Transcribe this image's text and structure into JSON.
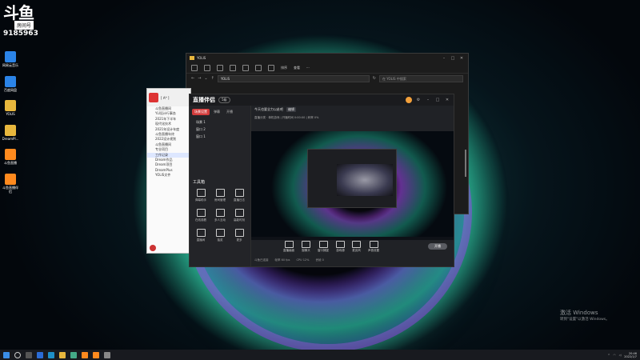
{
  "desktop": {
    "logo": {
      "mark": "斗鱼",
      "room_label": "房间号",
      "room_number": "9185963"
    },
    "icons": [
      {
        "label": "网易云音乐",
        "kind": "app-blue"
      },
      {
        "label": "百度网盘",
        "kind": "app-blue"
      },
      {
        "label": "YOLIS",
        "kind": "folder"
      },
      {
        "label": "DreamPl...",
        "kind": "folder"
      },
      {
        "label": "斗鱼直播",
        "kind": "app-orange"
      },
      {
        "label": "斗鱼直播伴侣",
        "kind": "app-orange"
      }
    ]
  },
  "explorer": {
    "title": "YOLIS",
    "toolbar": [
      "排序",
      "查看"
    ],
    "address": "YOLIS",
    "search_placeholder": "在 YOLIS 中搜索"
  },
  "side_window": {
    "title": "[ A* ]",
    "items": [
      "斗鱼直播间",
      "YLI设计行事务",
      "2021年下半年",
      "现代化技术",
      "2021年设计年度",
      "斗鱼直播年终",
      "2022设计规划",
      "斗鱼直播间",
      "专业项目",
      "工作记录",
      "Dream作品",
      "Dream项目",
      "DreamPlus",
      "YOLIS文件"
    ]
  },
  "stream_app": {
    "brand": "直播伴侣",
    "pill": "5级",
    "tabs": [
      "场景设置",
      "弹幕",
      "开播"
    ],
    "scenes": [
      "场景 1",
      "窗口 2",
      "窗口 1"
    ],
    "tool_heading": "工具箱",
    "tools": [
      "弹幕助手",
      "房间管理",
      "直播日志",
      "在线观看",
      "多人互动",
      "高能时刻",
      "直播间",
      "抽奖",
      "更多"
    ],
    "info_title": "今天也要全力以赴吧",
    "info_badge": "编辑",
    "info_line": "直播分类 · 单机游戏 | 开播时间 0:00:00 | 码率 0%",
    "controls": [
      "直播画面",
      "摄像头",
      "窗口捕捉",
      "游戏源",
      "麦克风",
      "声音设置"
    ],
    "go_live": "开播",
    "status": [
      "斗鱼已连接",
      "帧率 60 fps",
      "CPU 12%",
      "丢帧 0"
    ]
  },
  "watermark": {
    "line1": "激活 Windows",
    "line2": "转到\"设置\"以激活 Windows。"
  },
  "taskbar": {
    "time": "20:46",
    "date": "2022/1/7"
  }
}
